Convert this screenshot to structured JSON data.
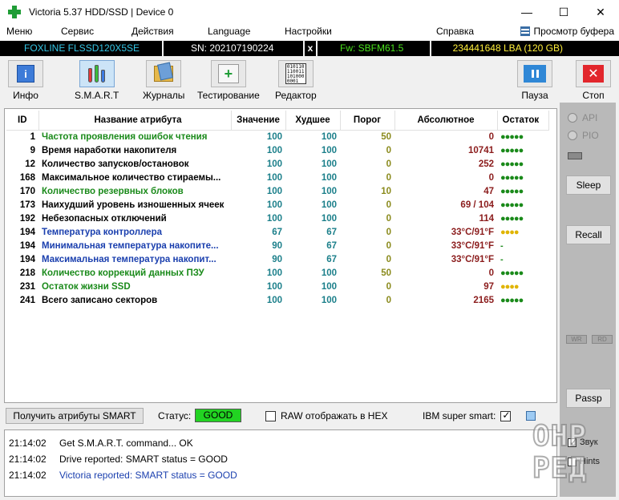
{
  "window": {
    "title": "Victoria 5.37 HDD/SSD | Device 0",
    "controls": {
      "minimize": "—",
      "maximize": "☐",
      "close": "✕"
    }
  },
  "menu": {
    "items": [
      "Меню",
      "Сервис",
      "Действия",
      "Language",
      "Настройки",
      "Справка"
    ],
    "buffer_view": "Просмотр буфера"
  },
  "drive": {
    "model": "FOXLINE FLSSD120X5SE",
    "serial": "SN: 202107190224",
    "x_mark": "x",
    "firmware": "Fw: SBFM61.5",
    "lba": "234441648 LBA (120 GB)"
  },
  "toolbar": {
    "info": "Инфо",
    "smart": "S.M.A.R.T",
    "journals": "Журналы",
    "testing": "Тестирование",
    "editor": "Редактор",
    "pause": "Пауза",
    "stop": "Стоп",
    "info_glyph": "i",
    "test_glyph": "+",
    "stop_glyph": "✕",
    "editor_glyph": "010110\n110011\n101000\n0001"
  },
  "smart_table": {
    "headers": {
      "id": "ID",
      "name": "Название атрибута",
      "value": "Значение",
      "worst": "Худшее",
      "threshold": "Порог",
      "absolute": "Абсолютное",
      "remaining": "Остаток"
    },
    "rows": [
      {
        "id": "1",
        "name": "Частота проявления ошибок чтения",
        "value": "100",
        "worst": "100",
        "threshold": "50",
        "absolute": "0",
        "remaining": "●●●●●",
        "name_color": "#1a8a1a",
        "rem_color": "#1a8a1a"
      },
      {
        "id": "9",
        "name": "Время наработки накопителя",
        "value": "100",
        "worst": "100",
        "threshold": "0",
        "absolute": "10741",
        "remaining": "●●●●●",
        "name_color": "#000000",
        "rem_color": "#1a8a1a"
      },
      {
        "id": "12",
        "name": "Количество запусков/остановок",
        "value": "100",
        "worst": "100",
        "threshold": "0",
        "absolute": "252",
        "remaining": "●●●●●",
        "name_color": "#000000",
        "rem_color": "#1a8a1a"
      },
      {
        "id": "168",
        "name": "Максимальное количество стираемы...",
        "value": "100",
        "worst": "100",
        "threshold": "0",
        "absolute": "0",
        "remaining": "●●●●●",
        "name_color": "#000000",
        "rem_color": "#1a8a1a"
      },
      {
        "id": "170",
        "name": "Количество резервных блоков",
        "value": "100",
        "worst": "100",
        "threshold": "10",
        "absolute": "47",
        "remaining": "●●●●●",
        "name_color": "#1a8a1a",
        "rem_color": "#1a8a1a"
      },
      {
        "id": "173",
        "name": "Наихудший уровень изношенных ячеек",
        "value": "100",
        "worst": "100",
        "threshold": "0",
        "absolute": "69 / 104",
        "remaining": "●●●●●",
        "name_color": "#000000",
        "rem_color": "#1a8a1a"
      },
      {
        "id": "192",
        "name": "Небезопасных отключений",
        "value": "100",
        "worst": "100",
        "threshold": "0",
        "absolute": "114",
        "remaining": "●●●●●",
        "name_color": "#000000",
        "rem_color": "#1a8a1a"
      },
      {
        "id": "194",
        "name": "Температура контроллера",
        "value": "67",
        "worst": "67",
        "threshold": "0",
        "absolute": "33°C/91°F",
        "remaining": "●●●●",
        "name_color": "#1a3fae",
        "rem_color": "#e0b400"
      },
      {
        "id": "194",
        "name": "Минимальная температура накопите...",
        "value": "90",
        "worst": "67",
        "threshold": "0",
        "absolute": "33°C/91°F",
        "remaining": "-",
        "name_color": "#1a3fae",
        "rem_color": "#1a8a1a"
      },
      {
        "id": "194",
        "name": "Максимальная температура накопит...",
        "value": "90",
        "worst": "67",
        "threshold": "0",
        "absolute": "33°C/91°F",
        "remaining": "-",
        "name_color": "#1a3fae",
        "rem_color": "#1a8a1a"
      },
      {
        "id": "218",
        "name": "Количество коррекций данных ПЗУ",
        "value": "100",
        "worst": "100",
        "threshold": "50",
        "absolute": "0",
        "remaining": "●●●●●",
        "name_color": "#1a8a1a",
        "rem_color": "#1a8a1a"
      },
      {
        "id": "231",
        "name": "Остаток жизни SSD",
        "value": "100",
        "worst": "100",
        "threshold": "0",
        "absolute": "97",
        "remaining": "●●●●",
        "name_color": "#1a8a1a",
        "rem_color": "#e0b400"
      },
      {
        "id": "241",
        "name": "Всего записано секторов",
        "value": "100",
        "worst": "100",
        "threshold": "0",
        "absolute": "2165",
        "remaining": "●●●●●",
        "name_color": "#000000",
        "rem_color": "#1a8a1a"
      }
    ]
  },
  "controls": {
    "get_smart": "Получить атрибуты SMART",
    "status_label": "Статус:",
    "status_value": "GOOD",
    "raw_hex": "RAW отображать в HEX",
    "raw_hex_checked": false,
    "ibm_smart": "IBM super smart:",
    "ibm_smart_checked": true,
    "status_color": "#22d322"
  },
  "log": [
    {
      "time": "21:14:02",
      "message": "Get S.M.A.R.T. command... OK",
      "color": "#000000"
    },
    {
      "time": "21:14:02",
      "message": "Drive reported: SMART status = GOOD",
      "color": "#000000"
    },
    {
      "time": "21:14:02",
      "message": "Victoria reported: SMART status = GOOD",
      "color": "#1a3fae"
    }
  ],
  "side": {
    "api": "API",
    "pio": "PIO",
    "sleep": "Sleep",
    "recall": "Recall",
    "wr": "WR",
    "rd": "RD",
    "passp": "Passp",
    "sound": "Звук",
    "hints": "Hints"
  },
  "watermark": {
    "line1": "ОНР",
    "line2": "РЕД"
  }
}
